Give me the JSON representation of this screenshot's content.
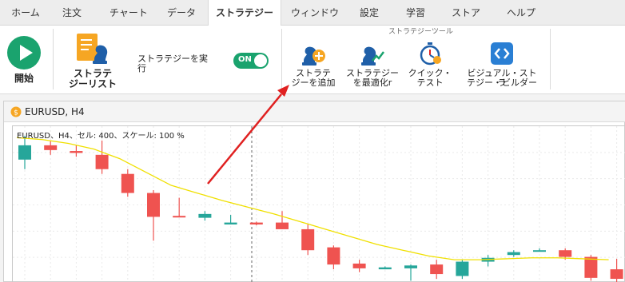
{
  "menu": {
    "items": [
      "ホーム",
      "注文",
      "チャート",
      "データ",
      "ストラテジー",
      "ウィンドウ",
      "設定",
      "学習",
      "ストア",
      "ヘルプ"
    ],
    "active_index": 4
  },
  "ribbon": {
    "start_label": "開始",
    "strategy_list_line1": "ストラテ",
    "strategy_list_line2": "ジーリスト",
    "run_strategy_label": "ストラテジーを実行",
    "toggle_label": "ON",
    "tools_group_title": "ストラテジーツール",
    "add_strategy_line1": "ストラテ",
    "add_strategy_line2": "ジーを追加",
    "optimize_line1": "ストラテジー",
    "optimize_line2": "を最適化r",
    "quick_test_line1": "クイック・",
    "quick_test_line2": "テスト",
    "visual_builder_line1": "ビジュアル・ストラ",
    "visual_builder_line2": "テジー・ビルダー"
  },
  "chart_window": {
    "title": "EURUSD, H4",
    "info": "EURUSD、H4、セル: 400、スケール: 100 %"
  },
  "colors": {
    "accent_green": "#1aa36e",
    "bull_candle": "#26a69a",
    "bear_candle": "#ef5350",
    "ma_line": "#f0e000",
    "arrow": "#e02020",
    "strategy_blue": "#1f5fa8",
    "builder_blue": "#2a7fd4"
  },
  "chart_data": {
    "type": "candlestick",
    "symbol": "EURUSD",
    "timeframe": "H4",
    "candles": [
      {
        "direction": "up",
        "open": 1.0765,
        "close": 1.078,
        "high": 1.079,
        "low": 1.0755
      },
      {
        "direction": "down",
        "open": 1.078,
        "close": 1.0775,
        "high": 1.0785,
        "low": 1.077
      },
      {
        "direction": "down",
        "open": 1.0774,
        "close": 1.0772,
        "high": 1.078,
        "low": 1.0768
      },
      {
        "direction": "down",
        "open": 1.077,
        "close": 1.0755,
        "high": 1.0785,
        "low": 1.075
      },
      {
        "direction": "down",
        "open": 1.075,
        "close": 1.073,
        "high": 1.0755,
        "low": 1.0726
      },
      {
        "direction": "down",
        "open": 1.073,
        "close": 1.0705,
        "high": 1.0733,
        "low": 1.068
      },
      {
        "direction": "down",
        "open": 1.0706,
        "close": 1.0705,
        "high": 1.0725,
        "low": 1.0705
      },
      {
        "direction": "up",
        "open": 1.0704,
        "close": 1.0708,
        "high": 1.0711,
        "low": 1.0701
      },
      {
        "direction": "up",
        "open": 1.0697,
        "close": 1.0699,
        "high": 1.0707,
        "low": 1.0697
      },
      {
        "direction": "down",
        "open": 1.0699,
        "close": 1.0697,
        "high": 1.07,
        "low": 1.0696
      },
      {
        "direction": "down",
        "open": 1.0699,
        "close": 1.0692,
        "high": 1.0711,
        "low": 1.0692
      },
      {
        "direction": "down",
        "open": 1.0692,
        "close": 1.067,
        "high": 1.0697,
        "low": 1.0665
      },
      {
        "direction": "down",
        "open": 1.0673,
        "close": 1.0655,
        "high": 1.0675,
        "low": 1.065
      },
      {
        "direction": "down",
        "open": 1.0656,
        "close": 1.0651,
        "high": 1.066,
        "low": 1.0647
      },
      {
        "direction": "up",
        "open": 1.065,
        "close": 1.0652,
        "high": 1.0653,
        "low": 1.065
      },
      {
        "direction": "up",
        "open": 1.0651,
        "close": 1.0654,
        "high": 1.0655,
        "low": 1.0638
      },
      {
        "direction": "down",
        "open": 1.0655,
        "close": 1.0645,
        "high": 1.066,
        "low": 1.064
      },
      {
        "direction": "up",
        "open": 1.0643,
        "close": 1.0658,
        "high": 1.066,
        "low": 1.064
      },
      {
        "direction": "up",
        "open": 1.0658,
        "close": 1.0662,
        "high": 1.0665,
        "low": 1.0653
      },
      {
        "direction": "up",
        "open": 1.0665,
        "close": 1.0668,
        "high": 1.067,
        "low": 1.0663
      },
      {
        "direction": "up",
        "open": 1.0669,
        "close": 1.067,
        "high": 1.0672,
        "low": 1.0669
      },
      {
        "direction": "down",
        "open": 1.067,
        "close": 1.0663,
        "high": 1.0672,
        "low": 1.066
      },
      {
        "direction": "down",
        "open": 1.0663,
        "close": 1.0641,
        "high": 1.0665,
        "low": 1.0638
      },
      {
        "direction": "down",
        "open": 1.065,
        "close": 1.064,
        "high": 1.0661,
        "low": 1.0635
      }
    ],
    "moving_average": [
      1.0788,
      1.0786,
      1.0782,
      1.0776,
      1.0766,
      1.0752,
      1.0738,
      1.073,
      1.0722,
      1.0715,
      1.0708,
      1.07,
      1.0692,
      1.0684,
      1.0676,
      1.067,
      1.0664,
      1.066,
      1.066,
      1.0661,
      1.0662,
      1.0662,
      1.0661,
      1.066
    ],
    "ylim": [
      1.0635,
      1.08
    ],
    "grid": true
  }
}
